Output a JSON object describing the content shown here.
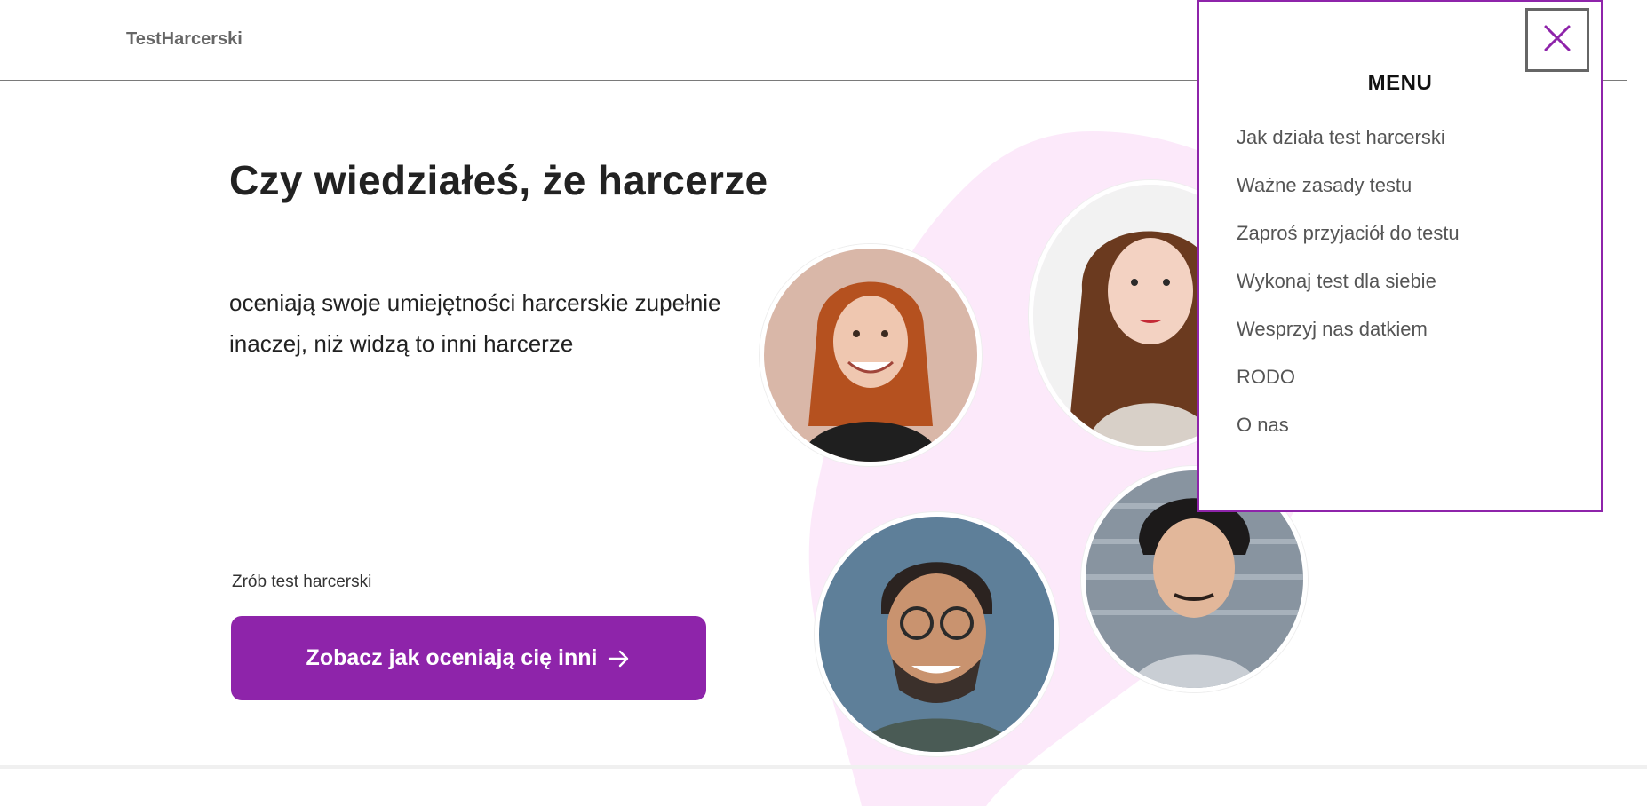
{
  "header": {
    "logo": "TestHarcerski"
  },
  "hero": {
    "title": "Czy wiedziałeś, że harcerze",
    "subtitle": "oceniają swoje umiejętności harcerskie zupełnie inaczej, niż widzą to inni harcerze",
    "cta_label": "Zrób test harcerski",
    "cta_button": "Zobacz jak oceniają cię inni",
    "cta_icon": "arrow-right-icon"
  },
  "colors": {
    "accent": "#8e24aa",
    "blob": "#fce9fa",
    "text": "#222222",
    "menu_text": "#555555"
  },
  "menu": {
    "title": "MENU",
    "close_icon": "close-icon",
    "items": [
      "Jak działa test harcerski",
      "Ważne zasady testu",
      "Zaproś przyjaciół do testu",
      "Wykonaj test dla siebie",
      "Wesprzyj nas datkiem",
      "RODO",
      "O nas"
    ]
  },
  "photos": [
    "woman-red-hair-photo",
    "woman-curly-hair-photo",
    "man-glasses-photo",
    "young-man-photo"
  ]
}
